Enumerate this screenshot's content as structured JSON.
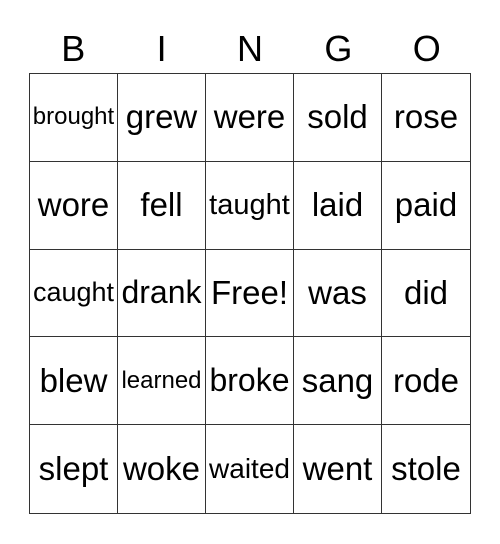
{
  "header": [
    "B",
    "I",
    "N",
    "G",
    "O"
  ],
  "cells": [
    [
      "brought",
      "grew",
      "were",
      "sold",
      "rose"
    ],
    [
      "wore",
      "fell",
      "taught",
      "laid",
      "paid"
    ],
    [
      "caught",
      "drank",
      "Free!",
      "was",
      "did"
    ],
    [
      "blew",
      "learned",
      "broke",
      "sang",
      "rode"
    ],
    [
      "slept",
      "woke",
      "waited",
      "went",
      "stole"
    ]
  ]
}
